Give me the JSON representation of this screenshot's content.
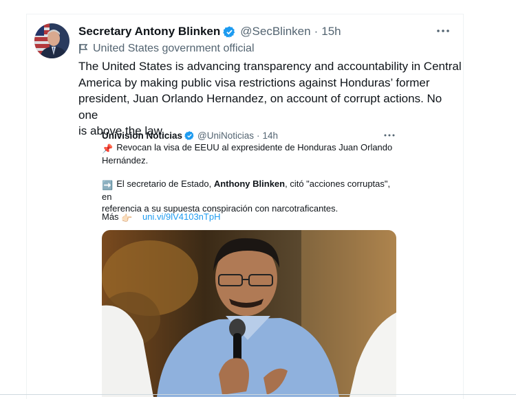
{
  "tweet": {
    "author_name": "Secretary Antony Blinken",
    "handle": "@SecBlinken",
    "separator": "·",
    "time": "15h",
    "affiliation_label": "United States government official",
    "text": "The United States is advancing transparency and accountability in Central\nAmerica by making public visa restrictions against Honduras’ former\npresident, Juan Orlando Hernandez, on account of corrupt actions. No one\nis above the law.",
    "icons": [
      "avatar",
      "verified-badge-icon",
      "more-options-icon",
      "government-flag-icon"
    ]
  },
  "quoted": {
    "author_name": "Univision Noticias",
    "handle": "@UniNoticias",
    "separator": "·",
    "time": "14h",
    "line1_emoji": "📌",
    "line1": "Revocan la visa de EEUU al expresidente de Honduras Juan Orlando",
    "line2": "Hernández.",
    "line3_emoji": "➡️",
    "line3_a": "El secretario de Estado, ",
    "line3_bold": "Anthony Blinken",
    "line3_b": ", citó \"acciones corruptas\", en",
    "line4": "referencia a su supuesta conspiración con narcotraficantes.",
    "mas_label": "Más",
    "mas_emoji": "👉🏻",
    "link": "uni.vi/9lV4103nTpH"
  },
  "colors": {
    "verified": "#1d9bf0",
    "secondary_text": "#536471",
    "link": "#1d9bf0"
  }
}
